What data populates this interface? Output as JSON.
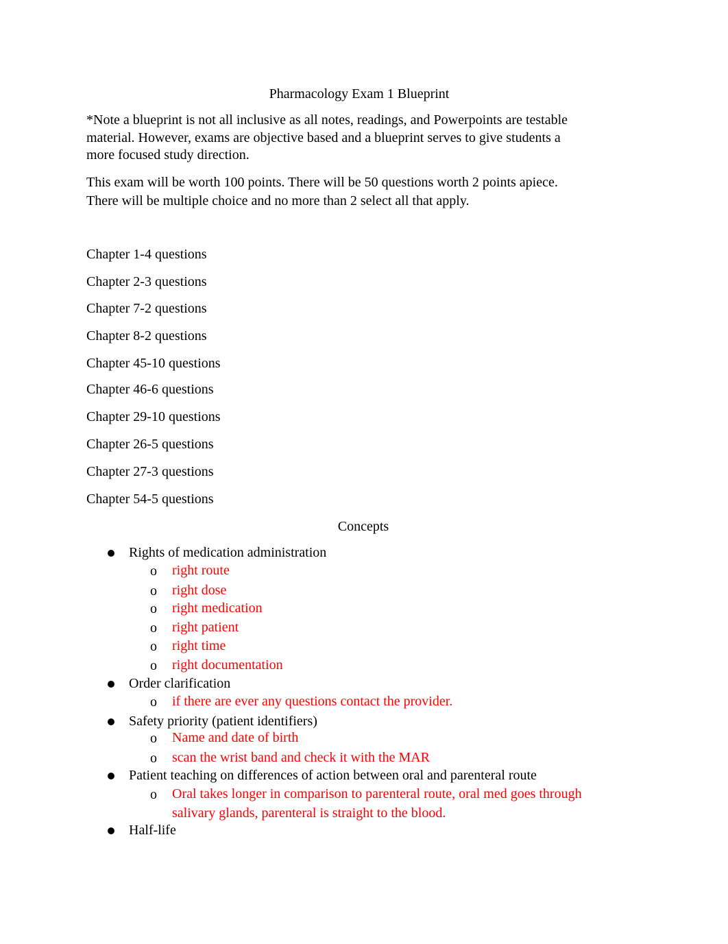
{
  "document": {
    "title": "Pharmacology Exam 1 Blueprint",
    "note": "*Note a blueprint is not all inclusive as all notes, readings, and Powerpoints are testable material.   However, exams are objective based and a blueprint serves to give students a more focused study direction.",
    "note_lines": [
      "*Note a blueprint is not all inclusive as all notes, readings, and Powerpoints are testable",
      "material.   However, exams are objective based and a blueprint serves to give students a",
      "more focused study direction."
    ],
    "exam_info_lines": [
      "This exam will be worth 100 points.    There will be 50 questions worth 2 points apiece.",
      "There will be multiple choice and no more than 2 select all that apply."
    ],
    "chapters": [
      "Chapter 1-4 questions",
      "Chapter 2-3 questions",
      "Chapter 7-2 questions",
      "Chapter 8-2 questions",
      "Chapter 45-10 questions",
      "Chapter 46-6 questions",
      "Chapter 29-10 questions",
      "Chapter 26-5 questions",
      "Chapter 27-3 questions",
      "Chapter 54-5 questions"
    ],
    "concepts_heading": "Concepts",
    "sub_bullet_glyph": "o",
    "concepts": [
      {
        "label": "Rights of medication administration",
        "items": [
          "right route",
          "right dose",
          "right medication",
          "right patient",
          "right time",
          "right documentation"
        ]
      },
      {
        "label": "Order clarification",
        "items": [
          "if there are ever any questions contact the provider."
        ]
      },
      {
        "label": "Safety priority (patient identifiers)",
        "items": [
          "Name and date of birth",
          "scan the wrist band and check it with the MAR"
        ]
      },
      {
        "label": "Patient teaching on differences of action between oral and parenteral route",
        "items_lines": [
          "Oral takes longer in comparison to parenteral route, oral med goes through",
          "salivary glands, parenteral is straight to the blood."
        ]
      },
      {
        "label": "Half-life",
        "items": []
      }
    ],
    "colors": {
      "answer_text": "#ff0000",
      "body_text": "#000000"
    }
  }
}
